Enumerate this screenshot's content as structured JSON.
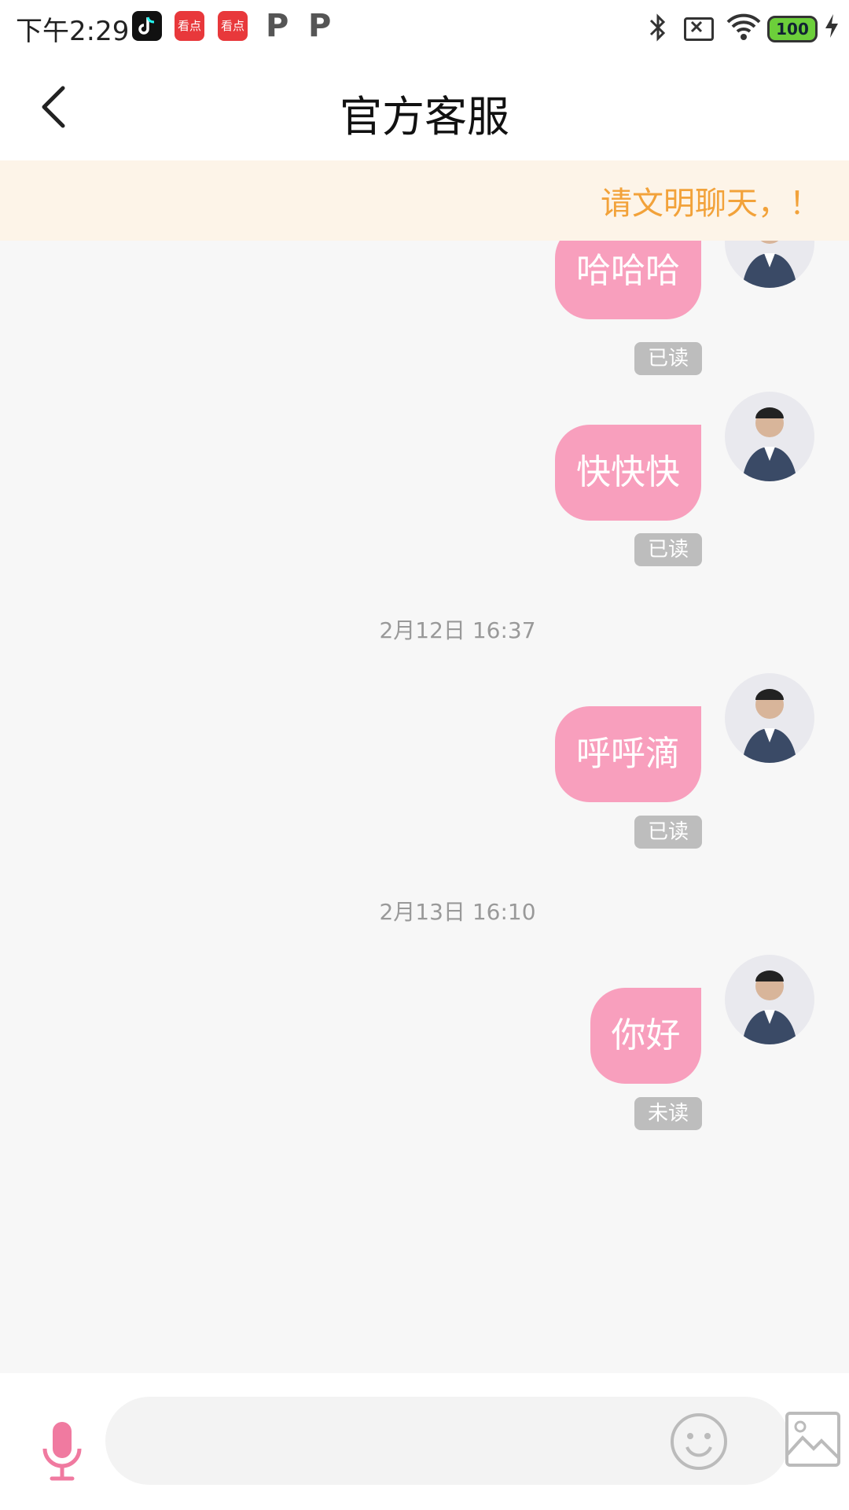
{
  "status_bar": {
    "time": "下午2:29",
    "notification_icons": [
      "tiktok-icon",
      "kandian-icon",
      "kandian-icon",
      "p-icon",
      "p-icon"
    ],
    "kandian_label": "看点",
    "battery_level": "100"
  },
  "header": {
    "title": "官方客服"
  },
  "notice": {
    "text": "请文明聊天，！"
  },
  "messages": [
    {
      "text": "哈哈哈",
      "status": "已读"
    },
    {
      "text": "快快快",
      "status": "已读"
    },
    {
      "timestamp": "2月12日 16:37"
    },
    {
      "text": "呼呼滴",
      "status": "已读"
    },
    {
      "timestamp": "2月13日 16:10"
    },
    {
      "text": "你好",
      "status": "未读"
    }
  ],
  "colors": {
    "bubble": "#f89fbd",
    "accent": "#f07aa0",
    "notice_text": "#f2a23a",
    "notice_bg": "#fdf4e8"
  }
}
